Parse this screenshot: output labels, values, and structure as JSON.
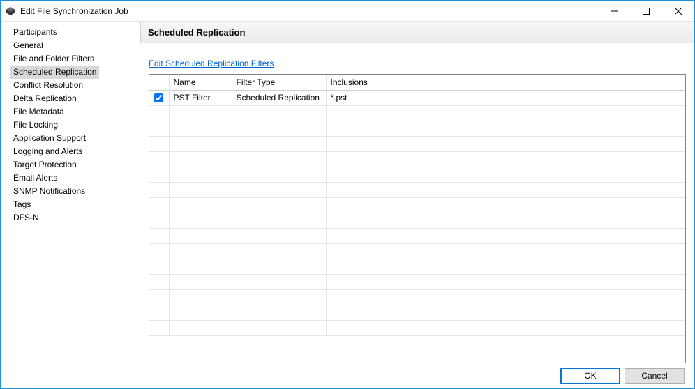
{
  "window": {
    "title": "Edit File Synchronization Job"
  },
  "sidebar": {
    "items": [
      {
        "label": "Participants"
      },
      {
        "label": "General"
      },
      {
        "label": "File and Folder Filters"
      },
      {
        "label": "Scheduled Replication"
      },
      {
        "label": "Conflict Resolution"
      },
      {
        "label": "Delta Replication"
      },
      {
        "label": "File Metadata"
      },
      {
        "label": "File Locking"
      },
      {
        "label": "Application Support"
      },
      {
        "label": "Logging and Alerts"
      },
      {
        "label": "Target Protection"
      },
      {
        "label": "Email Alerts"
      },
      {
        "label": "SNMP Notifications"
      },
      {
        "label": "Tags"
      },
      {
        "label": "DFS-N"
      }
    ],
    "selected_index": 3
  },
  "main": {
    "heading": "Scheduled Replication",
    "edit_link": "Edit Scheduled Replication Filters",
    "table": {
      "columns": [
        "",
        "Name",
        "Filter Type",
        "Inclusions",
        ""
      ],
      "rows": [
        {
          "checked": true,
          "name": "PST Filter",
          "filter_type": "Scheduled Replication",
          "inclusions": "*.pst"
        }
      ],
      "empty_row_count": 15
    }
  },
  "footer": {
    "ok": "OK",
    "cancel": "Cancel"
  }
}
